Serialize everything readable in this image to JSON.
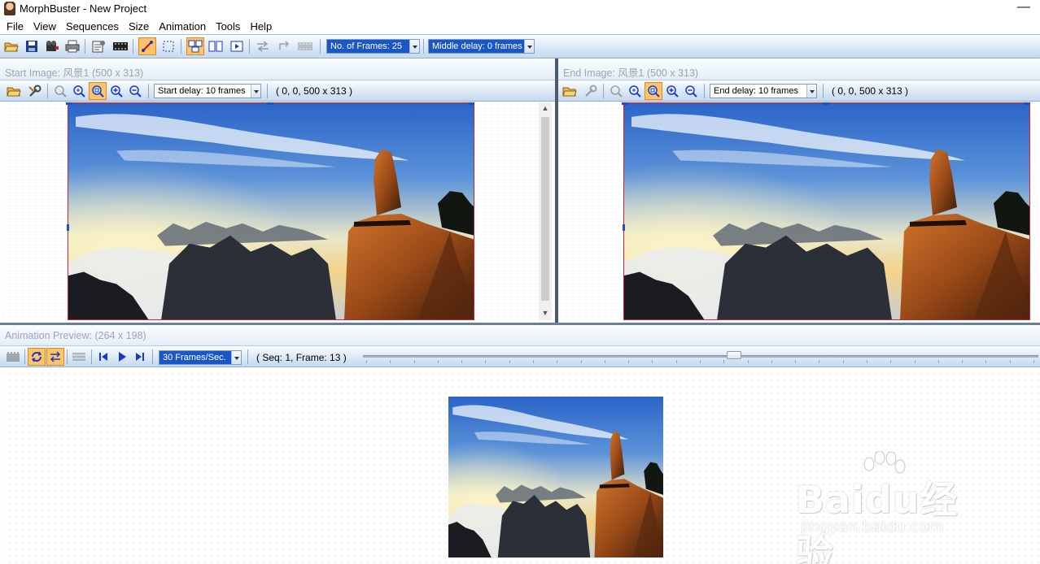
{
  "app": {
    "title": "MorphBuster - New Project",
    "minimize_glyph": "—"
  },
  "menu": [
    "File",
    "View",
    "Sequences",
    "Size",
    "Animation",
    "Tools",
    "Help"
  ],
  "main_toolbar": {
    "icons": [
      "open-folder-icon",
      "save-disk-icon",
      "export-movie-icon",
      "print-icon",
      "properties-icon",
      "film-icon",
      "line-tool-icon",
      "select-rect-icon",
      "layout-split-icon",
      "layout-compare-icon",
      "preview-frame-icon",
      "swap-sequence-icon",
      "rotate-sequence-icon",
      "morph-frames-icon"
    ],
    "frames_combo": "No. of Frames: 25",
    "middle_delay_combo": "Middle delay: 0 frames"
  },
  "start_panel": {
    "header": "Start Image: 风景1 (500 x 313)",
    "delay_combo": "Start delay: 10 frames",
    "coords": "( 0, 0, 500 x 313 )"
  },
  "end_panel": {
    "header": "End Image: 风景1 (500 x 313)",
    "delay_combo": "End delay: 10 frames",
    "coords": "( 0, 0, 500 x 313 )"
  },
  "preview_panel": {
    "header": "Animation Preview:  (264 x 198)",
    "fps_combo": "30 Frames/Sec.",
    "status": "( Seq: 1, Frame: 13 )",
    "seek_position": 0.55
  },
  "watermark": {
    "line1": "Baidu经验",
    "line2": "jingyan.baidu.com"
  },
  "colors": {
    "accent_blue": "#1a56c7",
    "active_orange": "#ffc36b",
    "selection_red": "#d0203a"
  }
}
